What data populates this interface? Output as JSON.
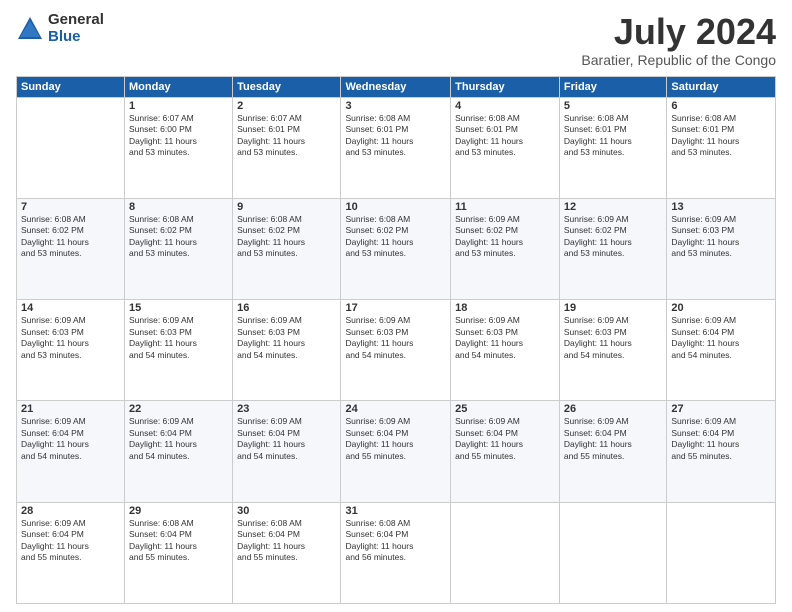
{
  "header": {
    "logo": {
      "general": "General",
      "blue": "Blue"
    },
    "title": "July 2024",
    "location": "Baratier, Republic of the Congo"
  },
  "weekdays": [
    "Sunday",
    "Monday",
    "Tuesday",
    "Wednesday",
    "Thursday",
    "Friday",
    "Saturday"
  ],
  "weeks": [
    [
      {
        "day": "",
        "info": ""
      },
      {
        "day": "1",
        "info": "Sunrise: 6:07 AM\nSunset: 6:00 PM\nDaylight: 11 hours\nand 53 minutes."
      },
      {
        "day": "2",
        "info": "Sunrise: 6:07 AM\nSunset: 6:01 PM\nDaylight: 11 hours\nand 53 minutes."
      },
      {
        "day": "3",
        "info": "Sunrise: 6:08 AM\nSunset: 6:01 PM\nDaylight: 11 hours\nand 53 minutes."
      },
      {
        "day": "4",
        "info": "Sunrise: 6:08 AM\nSunset: 6:01 PM\nDaylight: 11 hours\nand 53 minutes."
      },
      {
        "day": "5",
        "info": "Sunrise: 6:08 AM\nSunset: 6:01 PM\nDaylight: 11 hours\nand 53 minutes."
      },
      {
        "day": "6",
        "info": "Sunrise: 6:08 AM\nSunset: 6:01 PM\nDaylight: 11 hours\nand 53 minutes."
      }
    ],
    [
      {
        "day": "7",
        "info": "Sunrise: 6:08 AM\nSunset: 6:02 PM\nDaylight: 11 hours\nand 53 minutes."
      },
      {
        "day": "8",
        "info": "Sunrise: 6:08 AM\nSunset: 6:02 PM\nDaylight: 11 hours\nand 53 minutes."
      },
      {
        "day": "9",
        "info": "Sunrise: 6:08 AM\nSunset: 6:02 PM\nDaylight: 11 hours\nand 53 minutes."
      },
      {
        "day": "10",
        "info": "Sunrise: 6:08 AM\nSunset: 6:02 PM\nDaylight: 11 hours\nand 53 minutes."
      },
      {
        "day": "11",
        "info": "Sunrise: 6:09 AM\nSunset: 6:02 PM\nDaylight: 11 hours\nand 53 minutes."
      },
      {
        "day": "12",
        "info": "Sunrise: 6:09 AM\nSunset: 6:02 PM\nDaylight: 11 hours\nand 53 minutes."
      },
      {
        "day": "13",
        "info": "Sunrise: 6:09 AM\nSunset: 6:03 PM\nDaylight: 11 hours\nand 53 minutes."
      }
    ],
    [
      {
        "day": "14",
        "info": "Sunrise: 6:09 AM\nSunset: 6:03 PM\nDaylight: 11 hours\nand 53 minutes."
      },
      {
        "day": "15",
        "info": "Sunrise: 6:09 AM\nSunset: 6:03 PM\nDaylight: 11 hours\nand 54 minutes."
      },
      {
        "day": "16",
        "info": "Sunrise: 6:09 AM\nSunset: 6:03 PM\nDaylight: 11 hours\nand 54 minutes."
      },
      {
        "day": "17",
        "info": "Sunrise: 6:09 AM\nSunset: 6:03 PM\nDaylight: 11 hours\nand 54 minutes."
      },
      {
        "day": "18",
        "info": "Sunrise: 6:09 AM\nSunset: 6:03 PM\nDaylight: 11 hours\nand 54 minutes."
      },
      {
        "day": "19",
        "info": "Sunrise: 6:09 AM\nSunset: 6:03 PM\nDaylight: 11 hours\nand 54 minutes."
      },
      {
        "day": "20",
        "info": "Sunrise: 6:09 AM\nSunset: 6:04 PM\nDaylight: 11 hours\nand 54 minutes."
      }
    ],
    [
      {
        "day": "21",
        "info": "Sunrise: 6:09 AM\nSunset: 6:04 PM\nDaylight: 11 hours\nand 54 minutes."
      },
      {
        "day": "22",
        "info": "Sunrise: 6:09 AM\nSunset: 6:04 PM\nDaylight: 11 hours\nand 54 minutes."
      },
      {
        "day": "23",
        "info": "Sunrise: 6:09 AM\nSunset: 6:04 PM\nDaylight: 11 hours\nand 54 minutes."
      },
      {
        "day": "24",
        "info": "Sunrise: 6:09 AM\nSunset: 6:04 PM\nDaylight: 11 hours\nand 55 minutes."
      },
      {
        "day": "25",
        "info": "Sunrise: 6:09 AM\nSunset: 6:04 PM\nDaylight: 11 hours\nand 55 minutes."
      },
      {
        "day": "26",
        "info": "Sunrise: 6:09 AM\nSunset: 6:04 PM\nDaylight: 11 hours\nand 55 minutes."
      },
      {
        "day": "27",
        "info": "Sunrise: 6:09 AM\nSunset: 6:04 PM\nDaylight: 11 hours\nand 55 minutes."
      }
    ],
    [
      {
        "day": "28",
        "info": "Sunrise: 6:09 AM\nSunset: 6:04 PM\nDaylight: 11 hours\nand 55 minutes."
      },
      {
        "day": "29",
        "info": "Sunrise: 6:08 AM\nSunset: 6:04 PM\nDaylight: 11 hours\nand 55 minutes."
      },
      {
        "day": "30",
        "info": "Sunrise: 6:08 AM\nSunset: 6:04 PM\nDaylight: 11 hours\nand 55 minutes."
      },
      {
        "day": "31",
        "info": "Sunrise: 6:08 AM\nSunset: 6:04 PM\nDaylight: 11 hours\nand 56 minutes."
      },
      {
        "day": "",
        "info": ""
      },
      {
        "day": "",
        "info": ""
      },
      {
        "day": "",
        "info": ""
      }
    ]
  ]
}
